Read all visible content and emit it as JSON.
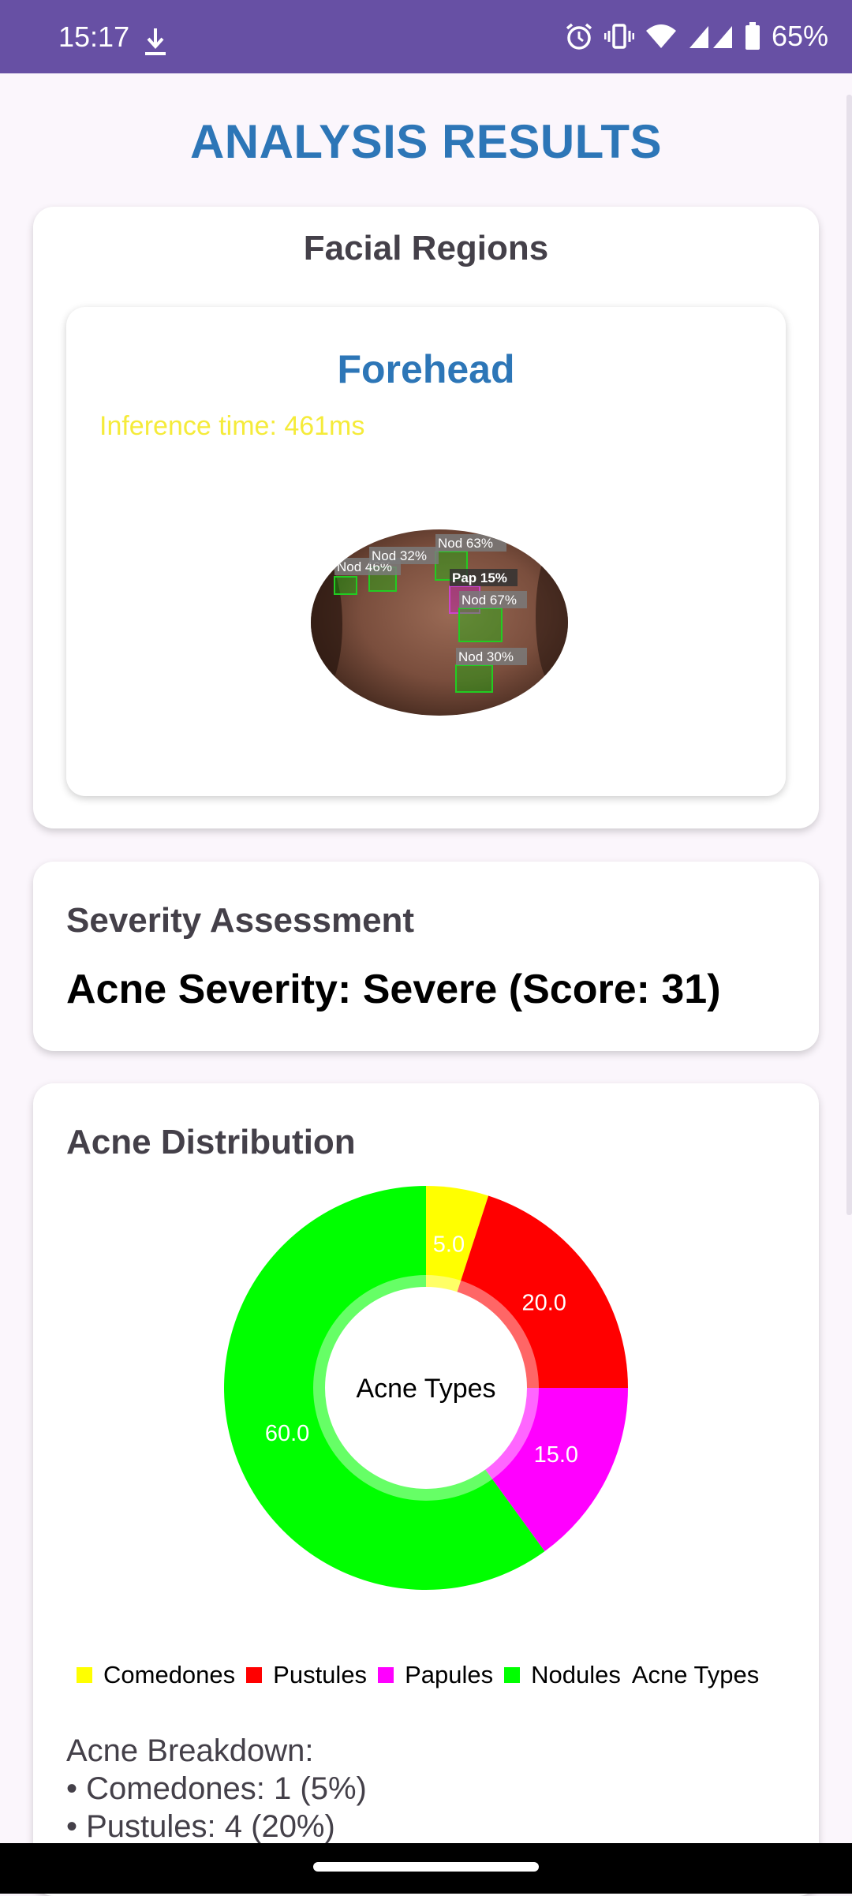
{
  "status_bar": {
    "time": "15:17",
    "battery": "65%",
    "icons": [
      "download-icon",
      "alarm-icon",
      "vibrate-icon",
      "wifi-icon",
      "signal-icon",
      "battery-icon"
    ]
  },
  "page": {
    "title": "ANALYSIS RESULTS"
  },
  "facial_regions": {
    "heading": "Facial Regions",
    "region": {
      "name": "Forehead",
      "inference_time": "Inference time: 461ms",
      "detections": [
        {
          "label": "Nod 46%",
          "type": "Nodules"
        },
        {
          "label": "Nod 32%",
          "type": "Nodules"
        },
        {
          "label": "Nod 63%",
          "type": "Nodules"
        },
        {
          "label": "Pap 15%",
          "type": "Papules"
        },
        {
          "label": "Nod 67%",
          "type": "Nodules"
        },
        {
          "label": "Nod 30%",
          "type": "Nodules"
        }
      ]
    }
  },
  "severity": {
    "heading": "Severity Assessment",
    "text": "Acne Severity: Severe (Score: 31)"
  },
  "distribution": {
    "heading": "Acne Distribution",
    "legend_suffix": "Acne Types",
    "breakdown_title": "Acne Breakdown:",
    "breakdown": [
      "• Comedones: 1 (5%)",
      "• Pustules: 4 (20%)"
    ]
  },
  "colors": {
    "accent": "#2d76b7",
    "status_bar": "#6750a4",
    "comedones": "#ffff00",
    "pustules": "#ff0000",
    "papules": "#ff00ff",
    "nodules": "#00ff00"
  },
  "chart_data": {
    "type": "pie",
    "title": "Acne Types",
    "categories": [
      "Comedones",
      "Pustules",
      "Papules",
      "Nodules"
    ],
    "values": [
      5.0,
      20.0,
      15.0,
      60.0
    ],
    "value_labels": [
      "5.0",
      "20.0",
      "15.0",
      "60.0"
    ],
    "colors": [
      "#ffff00",
      "#ff0000",
      "#ff00ff",
      "#00ff00"
    ],
    "donut": true,
    "legend_position": "bottom-left"
  }
}
